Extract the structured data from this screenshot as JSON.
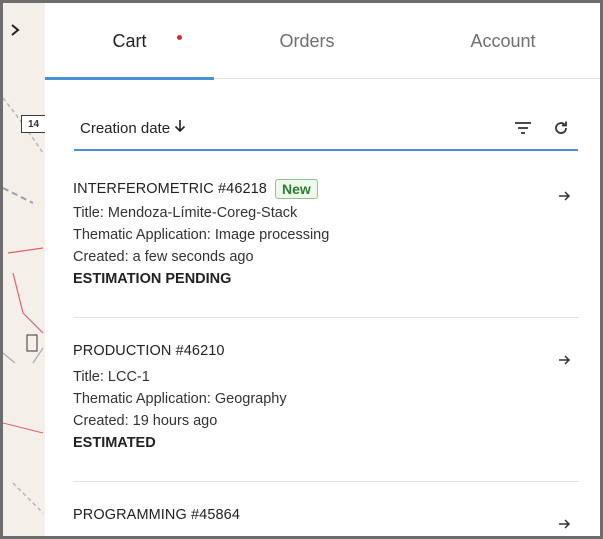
{
  "tabs": [
    {
      "label": "Cart",
      "active": true,
      "has_dot": true
    },
    {
      "label": "Orders",
      "active": false
    },
    {
      "label": "Account",
      "active": false
    }
  ],
  "map": {
    "badge": "14"
  },
  "sort": {
    "label": "Creation date",
    "direction_icon": "arrow-down-icon"
  },
  "items": [
    {
      "id": "INTERFEROMETRIC #46218",
      "badge": "New",
      "title": "Title: Mendoza-Límite-Coreg-Stack",
      "application": "Thematic Application: Image processing",
      "created": "Created: a few seconds ago",
      "status": "ESTIMATION PENDING"
    },
    {
      "id": "PRODUCTION #46210",
      "badge": "",
      "title": "Title: LCC-1",
      "application": "Thematic Application: Geography",
      "created": "Created: 19 hours ago",
      "status": "ESTIMATED"
    },
    {
      "id": "PROGRAMMING #45864"
    }
  ],
  "colors": {
    "accent": "#4a90d9",
    "dot": "#d32f2f",
    "badge_border": "#8cc68a"
  }
}
